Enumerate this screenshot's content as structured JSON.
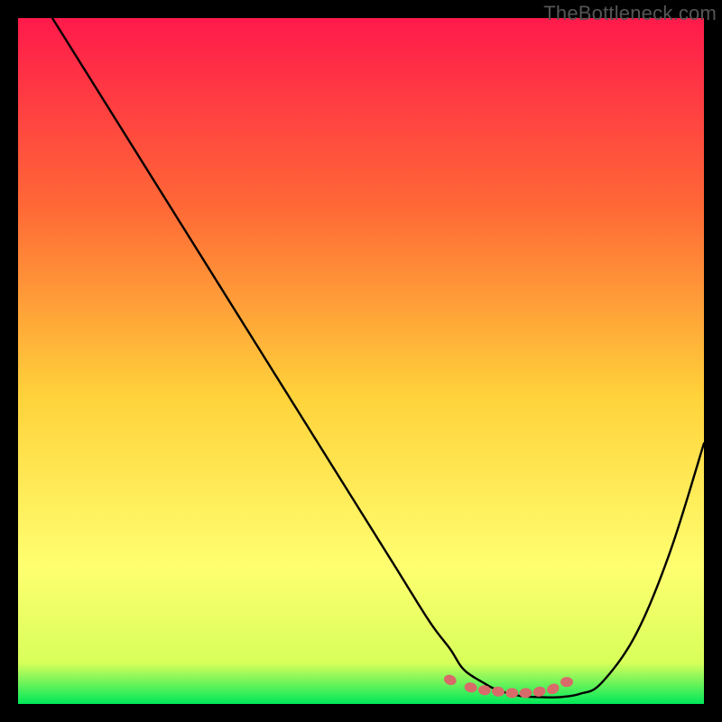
{
  "watermark": "TheBottleneck.com",
  "colors": {
    "gradient_top": "#ff1a4b",
    "gradient_mid_upper": "#ff6a36",
    "gradient_mid": "#ffd23a",
    "gradient_mid_lower": "#ffff70",
    "gradient_bottom": "#00e85a",
    "curve": "#000000",
    "marker": "#d86a6a",
    "frame": "#000000"
  },
  "chart_data": {
    "type": "line",
    "title": "",
    "xlabel": "",
    "ylabel": "",
    "xlim": [
      0,
      100
    ],
    "ylim": [
      0,
      100
    ],
    "curve": {
      "x": [
        5,
        10,
        15,
        20,
        25,
        30,
        35,
        40,
        45,
        50,
        55,
        60,
        63,
        65,
        68,
        70,
        73,
        76,
        79,
        82,
        85,
        90,
        95,
        100
      ],
      "y": [
        100,
        92,
        84,
        76,
        68,
        60,
        52,
        44,
        36,
        28,
        20,
        12,
        8,
        5,
        3,
        2,
        1.2,
        1,
        1,
        1.5,
        3,
        10,
        22,
        38
      ]
    },
    "markers": {
      "x": [
        63,
        66,
        68,
        70,
        72,
        74,
        76,
        78,
        80
      ],
      "y": [
        3.5,
        2.4,
        2.0,
        1.8,
        1.6,
        1.6,
        1.8,
        2.2,
        3.2
      ]
    },
    "gradient_meaning": "background vertical gradient from red (high bottleneck) through orange/yellow to green (low bottleneck)"
  }
}
